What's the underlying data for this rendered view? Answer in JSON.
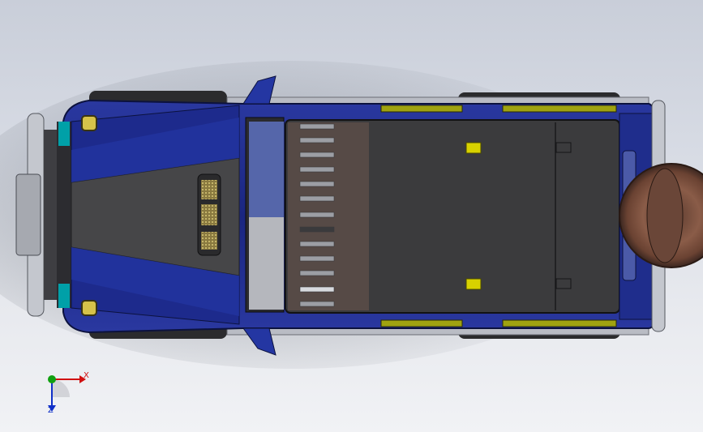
{
  "viewport": {
    "background_top": "#c9ced9",
    "background_bottom": "#f1f2f5",
    "model": {
      "body_color": "#1f2d8c",
      "roof_color": "#3a3a3c",
      "hood_center_color": "#4a4a4c",
      "marker_color": "#d8d200",
      "spare_tire_color": "#7a5240"
    }
  },
  "triad": {
    "x_label": "X",
    "z_label": "Z",
    "x_color": "#d01010",
    "y_color": "#10a010",
    "z_color": "#1030c8"
  }
}
